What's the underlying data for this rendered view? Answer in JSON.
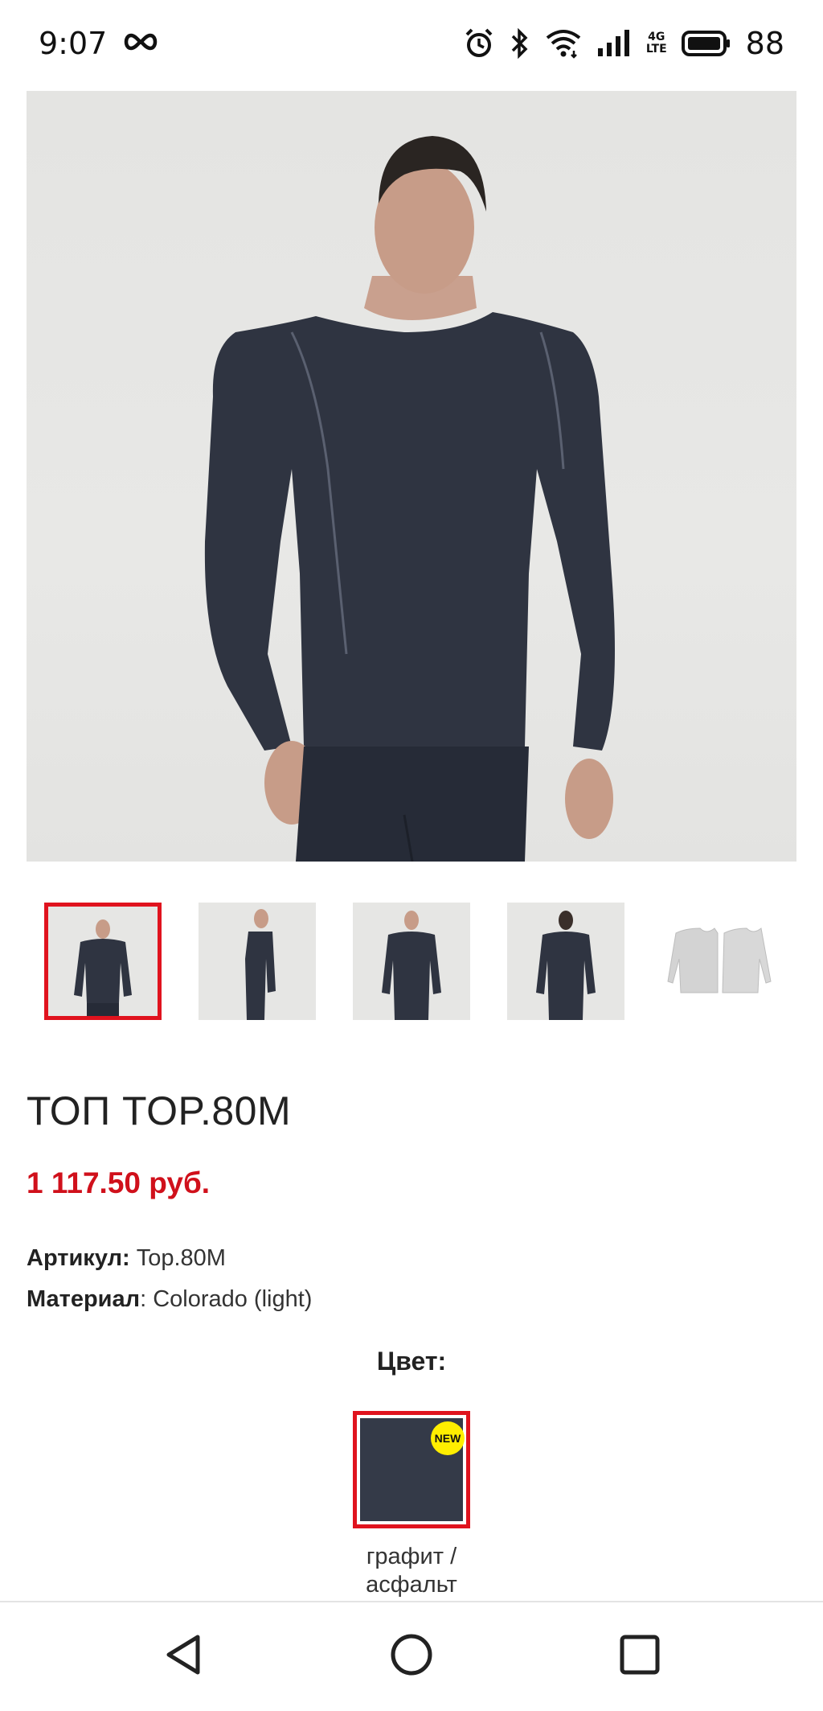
{
  "status_bar": {
    "time": "9:07",
    "battery": "88",
    "network": "4G LTE",
    "network_top": "4G",
    "network_bottom": "LTE",
    "icons": [
      "infinity-icon",
      "alarm-icon",
      "bluetooth-icon",
      "wifi-icon",
      "signal-icon",
      "battery-icon"
    ]
  },
  "product": {
    "title": "ТОП TOP.80M",
    "price": "1 117.50 руб.",
    "sku_label": "Артикул:",
    "sku_value": "Top.80M",
    "material_label": "Материал",
    "material_value": ": Colorado (light)"
  },
  "gallery": {
    "thumbnails": [
      "front-view",
      "side-view",
      "front-view-2",
      "back-view",
      "flat-lay-light"
    ],
    "selected_index": 0
  },
  "color_section": {
    "heading": "Цвет:",
    "swatch_badge": "NEW",
    "swatch_name": "графит /\nасфальт",
    "swatch_color": "#343a48"
  },
  "colors": {
    "accent": "#e0131e",
    "price": "#d0101b",
    "badge": "#ffee00"
  },
  "nav_bar": {
    "icons": [
      "back-icon",
      "home-icon",
      "recents-icon"
    ]
  }
}
